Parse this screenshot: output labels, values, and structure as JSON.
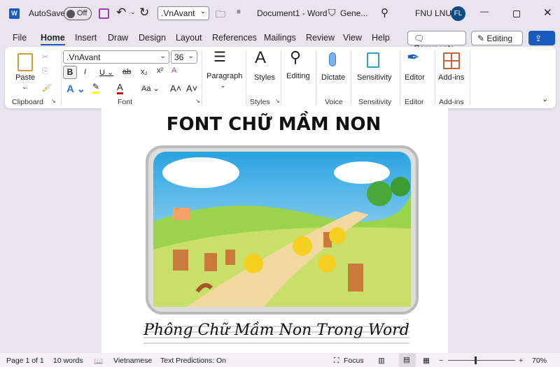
{
  "titlebar": {
    "autosave": "AutoSave",
    "toggle": "Off",
    "font": ".VnAvant",
    "doc_title": "Document1  -  Word",
    "sensitivity": "Gene...",
    "user": "FNU LNU",
    "initials": "FL"
  },
  "menu": [
    "File",
    "Home",
    "Insert",
    "Draw",
    "Design",
    "Layout",
    "References",
    "Mailings",
    "Review",
    "View",
    "Help"
  ],
  "buttons": {
    "comments": "Comments",
    "editing": "Editing"
  },
  "ribbon": {
    "paste": "Paste",
    "font_name": ".VnAvant",
    "font_size": "36",
    "groups": {
      "clipboard": "Clipboard",
      "font": "Font",
      "styles": "Styles",
      "voice": "Voice",
      "sensitivity": "Sensitivity",
      "editor": "Editor",
      "addins": "Add-ins"
    },
    "paragraph": "Paragraph",
    "styles": "Styles",
    "editing": "Editing",
    "dictate": "Dictate",
    "sensitivity": "Sensitivity",
    "editor": "Editor",
    "addins": "Add-ins"
  },
  "document": {
    "heading": "FONT CHỮ MẦM NON",
    "script_text": "Phông Chữ Mầm Non Trong Word"
  },
  "status": {
    "page": "Page 1 of 1",
    "words": "10 words",
    "language": "Vietnamese",
    "predictions": "Text Predictions: On",
    "focus": "Focus",
    "zoom": "70%"
  },
  "colors": {
    "accent": "#185abd",
    "avatar": "#0f4c81"
  }
}
